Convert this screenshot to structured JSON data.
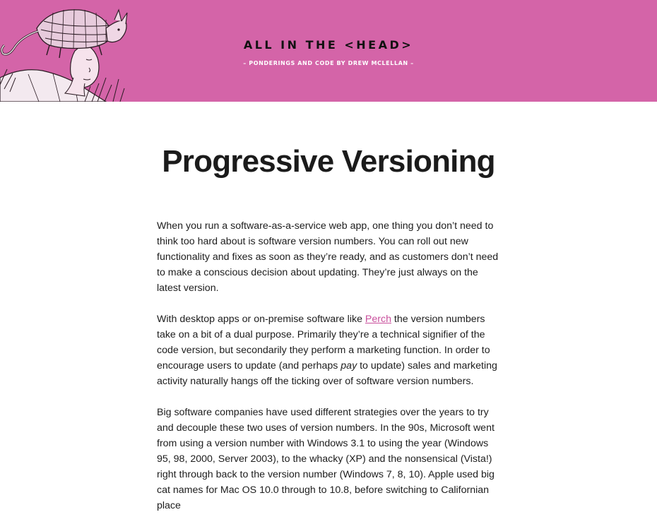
{
  "header": {
    "site_title": "ALL IN THE <HEAD>",
    "tagline": "– PONDERINGS AND CODE BY DREW MCLELLAN –",
    "background_color": "#d464a8",
    "illustration": "armadillo-head-illustration"
  },
  "post": {
    "title": "Progressive Versioning",
    "p1": "When you run a software-as-a-service web app, one thing you don’t need to think too hard about is software version numbers. You can roll out new functionality and fixes as soon as they’re ready, and as customers don’t need to make a conscious decision about updating. They’re just always on the latest version.",
    "p2_before_link": "With desktop apps or on-premise software like ",
    "p2_link": "Perch",
    "p2_after_link": " the version numbers take on a bit of a dual purpose. Primarily they’re a technical signifier of the code version, but secondarily they perform a marketing function. In order to encourage users to update (and perhaps ",
    "p2_emphasis": "pay",
    "p2_end": " to update) sales and marketing activity naturally hangs off the ticking over of software version numbers.",
    "p3": "Big software companies have used different strategies over the years to try and decouple these two uses of version numbers. In the 90s, Microsoft went from using a version number with Windows 3.1 to using the year (Windows 95, 98, 2000, Server 2003), to the whacky (XP) and the nonsensical (Vista!) right through back to the version number (Windows 7, 8, 10). Apple used big cat names for Mac OS 10.0 through to 10.8, before switching to Californian place",
    "link_color": "#c94f9c"
  }
}
